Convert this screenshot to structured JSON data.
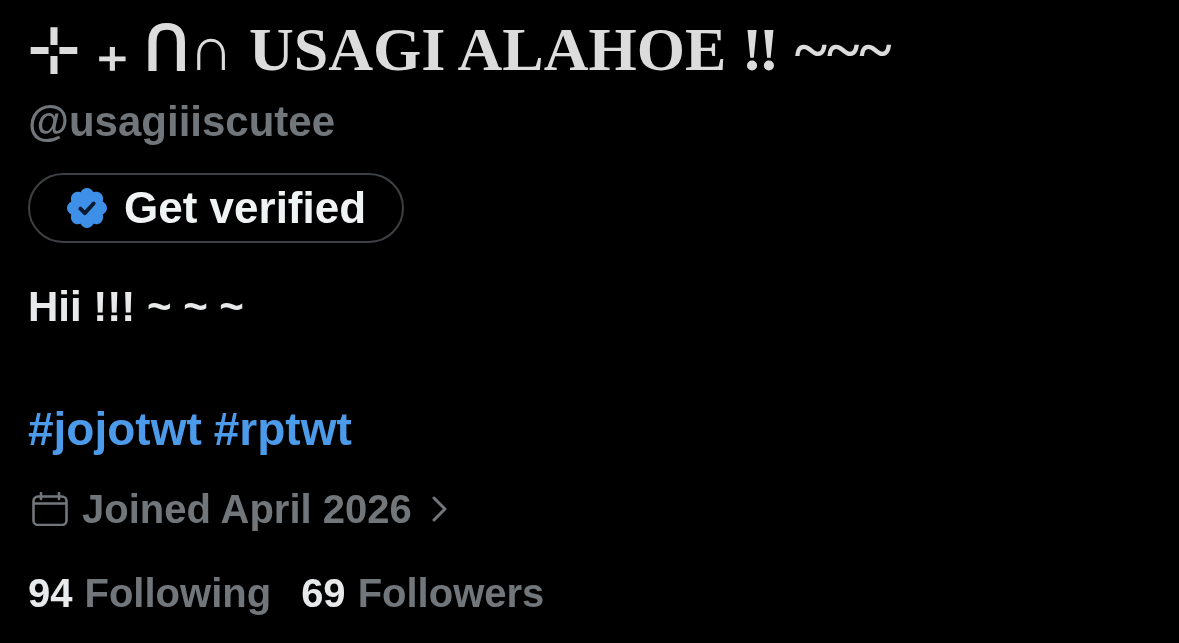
{
  "profile": {
    "display_name": "⊹ ₊ Ո∩ USAGI ALAHOE ‼ ~~~",
    "handle": "@usagiiiscutee"
  },
  "get_verified_button": {
    "label": "Get verified"
  },
  "bio": {
    "text": "Hii !!! ~ ~ ~",
    "hashtags": [
      "#jojotwt",
      "#rptwt"
    ]
  },
  "joined": {
    "text": "Joined April 2026"
  },
  "stats": [
    {
      "count": "94",
      "label": "Following"
    },
    {
      "count": "69",
      "label": "Followers"
    }
  ]
}
